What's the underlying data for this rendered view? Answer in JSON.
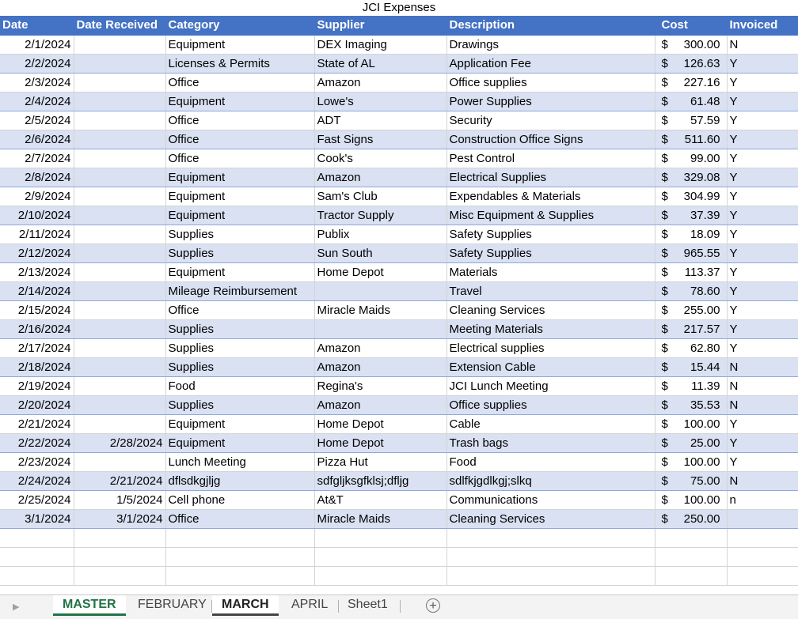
{
  "title": "JCI Expenses",
  "headers": [
    "Date",
    "Date Received",
    "Category",
    "Supplier",
    "Description",
    "Cost",
    "Invoiced"
  ],
  "rows": [
    {
      "date": "2/1/2024",
      "received": "",
      "category": "Equipment",
      "supplier": "DEX Imaging",
      "description": "Drawings",
      "cost": "300.00",
      "invoiced": "N"
    },
    {
      "date": "2/2/2024",
      "received": "",
      "category": "Licenses & Permits",
      "supplier": "State of AL",
      "description": "Application Fee",
      "cost": "126.63",
      "invoiced": "Y"
    },
    {
      "date": "2/3/2024",
      "received": "",
      "category": "Office",
      "supplier": "Amazon",
      "description": "Office supplies",
      "cost": "227.16",
      "invoiced": "Y"
    },
    {
      "date": "2/4/2024",
      "received": "",
      "category": "Equipment",
      "supplier": "Lowe's",
      "description": "Power Supplies",
      "cost": "61.48",
      "invoiced": "Y"
    },
    {
      "date": "2/5/2024",
      "received": "",
      "category": "Office",
      "supplier": "ADT",
      "description": "Security",
      "cost": "57.59",
      "invoiced": "Y"
    },
    {
      "date": "2/6/2024",
      "received": "",
      "category": "Office",
      "supplier": "Fast Signs",
      "description": "Construction Office Signs",
      "cost": "511.60",
      "invoiced": "Y"
    },
    {
      "date": "2/7/2024",
      "received": "",
      "category": "Office",
      "supplier": "Cook's",
      "description": "Pest Control",
      "cost": "99.00",
      "invoiced": "Y"
    },
    {
      "date": "2/8/2024",
      "received": "",
      "category": "Equipment",
      "supplier": "Amazon",
      "description": "Electrical Supplies",
      "cost": "329.08",
      "invoiced": "Y"
    },
    {
      "date": "2/9/2024",
      "received": "",
      "category": "Equipment",
      "supplier": "Sam's Club",
      "description": "Expendables & Materials",
      "cost": "304.99",
      "invoiced": "Y"
    },
    {
      "date": "2/10/2024",
      "received": "",
      "category": "Equipment",
      "supplier": "Tractor Supply",
      "description": "Misc Equipment & Supplies",
      "cost": "37.39",
      "invoiced": "Y"
    },
    {
      "date": "2/11/2024",
      "received": "",
      "category": "Supplies",
      "supplier": "Publix",
      "description": "Safety Supplies",
      "cost": "18.09",
      "invoiced": "Y"
    },
    {
      "date": "2/12/2024",
      "received": "",
      "category": "Supplies",
      "supplier": "Sun South",
      "description": "Safety Supplies",
      "cost": "965.55",
      "invoiced": "Y"
    },
    {
      "date": "2/13/2024",
      "received": "",
      "category": "Equipment",
      "supplier": "Home Depot",
      "description": "Materials",
      "cost": "113.37",
      "invoiced": "Y"
    },
    {
      "date": "2/14/2024",
      "received": "",
      "category": "Mileage Reimbursement",
      "supplier": "",
      "description": "Travel",
      "cost": "78.60",
      "invoiced": "Y"
    },
    {
      "date": "2/15/2024",
      "received": "",
      "category": "Office",
      "supplier": "Miracle Maids",
      "description": "Cleaning Services",
      "cost": "255.00",
      "invoiced": "Y"
    },
    {
      "date": "2/16/2024",
      "received": "",
      "category": "Supplies",
      "supplier": "",
      "description": "Meeting Materials",
      "cost": "217.57",
      "invoiced": "Y"
    },
    {
      "date": "2/17/2024",
      "received": "",
      "category": "Supplies",
      "supplier": "Amazon",
      "description": "Electrical supplies",
      "cost": "62.80",
      "invoiced": "Y"
    },
    {
      "date": "2/18/2024",
      "received": "",
      "category": "Supplies",
      "supplier": "Amazon",
      "description": "Extension Cable",
      "cost": "15.44",
      "invoiced": "N"
    },
    {
      "date": "2/19/2024",
      "received": "",
      "category": "Food",
      "supplier": "Regina's",
      "description": "JCI Lunch Meeting",
      "cost": "11.39",
      "invoiced": "N"
    },
    {
      "date": "2/20/2024",
      "received": "",
      "category": "Supplies",
      "supplier": "Amazon",
      "description": "Office supplies",
      "cost": "35.53",
      "invoiced": "N"
    },
    {
      "date": "2/21/2024",
      "received": "",
      "category": "Equipment",
      "supplier": "Home Depot",
      "description": "Cable",
      "cost": "100.00",
      "invoiced": "Y"
    },
    {
      "date": "2/22/2024",
      "received": "2/28/2024",
      "category": "Equipment",
      "supplier": "Home Depot",
      "description": "Trash bags",
      "cost": "25.00",
      "invoiced": "Y"
    },
    {
      "date": "2/23/2024",
      "received": "",
      "category": "Lunch Meeting",
      "supplier": "Pizza Hut",
      "description": "Food",
      "cost": "100.00",
      "invoiced": "Y"
    },
    {
      "date": "2/24/2024",
      "received": "2/21/2024",
      "category": "dflsdkgjljg",
      "supplier": "sdfgljksgfklsj;dfljg",
      "description": "sdlfkjgdlkgj;slkq",
      "cost": "75.00",
      "invoiced": "N"
    },
    {
      "date": "2/25/2024",
      "received": "1/5/2024",
      "category": "Cell phone",
      "supplier": "At&T",
      "description": "Communications",
      "cost": "100.00",
      "invoiced": "n"
    },
    {
      "date": "3/1/2024",
      "received": "3/1/2024",
      "category": "Office",
      "supplier": "Miracle Maids",
      "description": "Cleaning Services",
      "cost": "250.00",
      "invoiced": ""
    }
  ],
  "currency_symbol": "$",
  "tabs": [
    "MASTER",
    "FEBRUARY",
    "MARCH",
    "APRIL",
    "Sheet1"
  ],
  "active_tab": "MASTER",
  "add_sheet_label": "+",
  "colors": {
    "header_bg": "#4472c4",
    "band_bg": "#d9e1f2",
    "active_tab": "#217346"
  }
}
